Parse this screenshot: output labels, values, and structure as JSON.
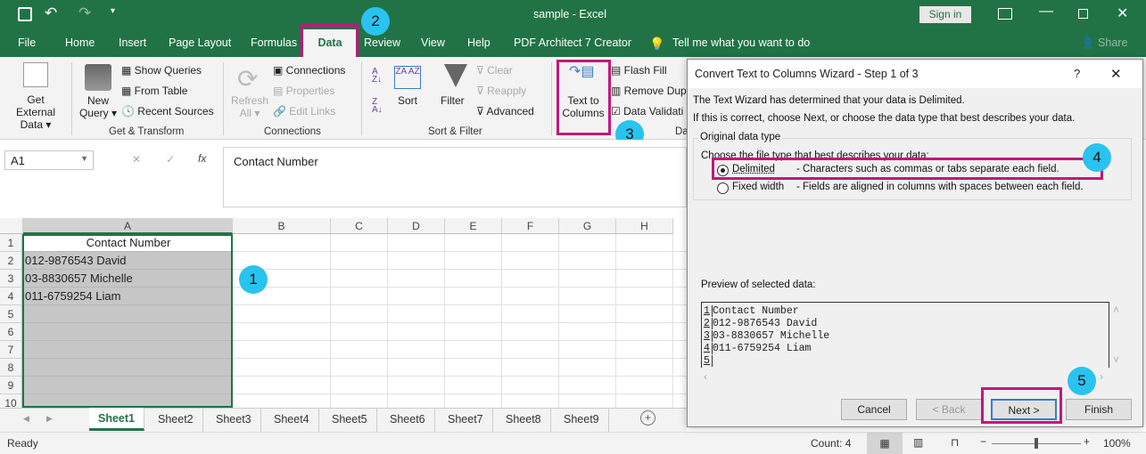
{
  "window": {
    "title": "sample  -  Excel",
    "sign_in": "Sign in",
    "share": "Share"
  },
  "tabs": [
    "File",
    "Home",
    "Insert",
    "Page Layout",
    "Formulas",
    "Data",
    "Review",
    "View",
    "Help",
    "PDF Architect 7 Creator"
  ],
  "tell_me": "Tell me what you want to do",
  "ribbon": {
    "get_external": [
      "Get External",
      "Data"
    ],
    "new_query": [
      "New",
      "Query"
    ],
    "show_queries": "Show Queries",
    "from_table": "From Table",
    "recent_sources": "Recent Sources",
    "group_get_transform": "Get & Transform",
    "refresh": [
      "Refresh",
      "All"
    ],
    "connections": "Connections",
    "properties": "Properties",
    "edit_links": "Edit Links",
    "group_connections": "Connections",
    "sort": "Sort",
    "filter": "Filter",
    "clear": "Clear",
    "reapply": "Reapply",
    "advanced": "Advanced",
    "group_sort_filter": "Sort & Filter",
    "text_to_columns": [
      "Text to",
      "Columns"
    ],
    "flash_fill": "Flash Fill",
    "remove_dup": "Remove Dup",
    "data_validation": "Data Validati",
    "group_data_tools": "Da"
  },
  "formula_bar": {
    "name_box": "A1",
    "fx": "fx",
    "value": "Contact Number"
  },
  "columns": [
    "A",
    "B",
    "C",
    "D",
    "E",
    "F",
    "G",
    "H"
  ],
  "rows": [
    "1",
    "2",
    "3",
    "4",
    "5",
    "6",
    "7",
    "8",
    "9",
    "10"
  ],
  "cells": [
    "Contact Number",
    "012-9876543 David",
    "03-8830657 Michelle",
    "011-6759254 Liam"
  ],
  "sheets": [
    "Sheet1",
    "Sheet2",
    "Sheet3",
    "Sheet4",
    "Sheet5",
    "Sheet6",
    "Sheet7",
    "Sheet8",
    "Sheet9"
  ],
  "status": {
    "ready": "Ready",
    "count": "Count: 4",
    "zoom": "100%"
  },
  "dialog": {
    "title": "Convert Text to Columns Wizard - Step 1 of 3",
    "help": "?",
    "close": "✕",
    "line1": "The Text Wizard has determined that your data is Delimited.",
    "line2": "If this is correct, choose Next, or choose the data type that best describes your data.",
    "group": "Original data type",
    "choose": "Choose the file type that best describes your data:",
    "options": [
      {
        "label": "Delimited",
        "desc": "- Characters such as commas or tabs separate each field.",
        "selected": true
      },
      {
        "label": "Fixed width",
        "desc": "- Fields are aligned in columns with spaces between each field.",
        "selected": false
      }
    ],
    "preview_label": "Preview of selected data:",
    "preview_rows": [
      [
        "1",
        "Contact Number"
      ],
      [
        "2",
        "012-9876543 David"
      ],
      [
        "3",
        "03-8830657 Michelle"
      ],
      [
        "4",
        "011-6759254 Liam"
      ],
      [
        "5",
        ""
      ]
    ],
    "buttons": {
      "cancel": "Cancel",
      "back": "< Back",
      "next": "Next >",
      "finish": "Finish"
    }
  },
  "annotations": [
    "1",
    "2",
    "3",
    "4",
    "5"
  ],
  "colors": {
    "excel_green": "#217346",
    "highlight": "#c2177a",
    "badge": "#29c3f0"
  }
}
